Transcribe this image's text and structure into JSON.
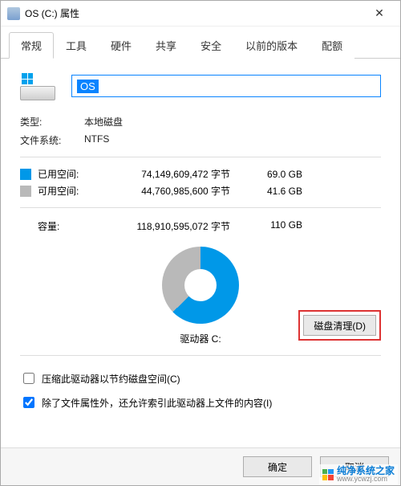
{
  "window": {
    "title": "OS (C:) 属性"
  },
  "tabs": [
    "常规",
    "工具",
    "硬件",
    "共享",
    "安全",
    "以前的版本",
    "配额"
  ],
  "active_tab_index": 0,
  "drive": {
    "name": "OS",
    "type_label": "类型:",
    "type_value": "本地磁盘",
    "fs_label": "文件系统:",
    "fs_value": "NTFS",
    "used_label": "已用空间:",
    "used_bytes": "74,149,609,472 字节",
    "used_gb": "69.0 GB",
    "free_label": "可用空间:",
    "free_bytes": "44,760,985,600 字节",
    "free_gb": "41.6 GB",
    "capacity_label": "容量:",
    "capacity_bytes": "118,910,595,072 字节",
    "capacity_gb": "110 GB",
    "label_text": "驱动器 C:"
  },
  "buttons": {
    "cleanup": "磁盘清理(D)",
    "ok": "确定",
    "cancel": "取消"
  },
  "checks": {
    "compress": "压缩此驱动器以节约磁盘空间(C)",
    "index": "除了文件属性外，还允许索引此驱动器上文件的内容(I)",
    "compress_checked": false,
    "index_checked": true
  },
  "watermark": {
    "line1": "纯净系统之家",
    "line2": "www.ycwzj.com"
  },
  "chart_data": {
    "type": "pie",
    "title": "驱动器 C:",
    "series": [
      {
        "name": "已用空间",
        "value_bytes": 74149609472,
        "value_gb": 69.0,
        "color": "#0098e8"
      },
      {
        "name": "可用空间",
        "value_bytes": 44760985600,
        "value_gb": 41.6,
        "color": "#b9b9b9"
      }
    ],
    "total_bytes": 118910595072,
    "total_gb": 110
  }
}
